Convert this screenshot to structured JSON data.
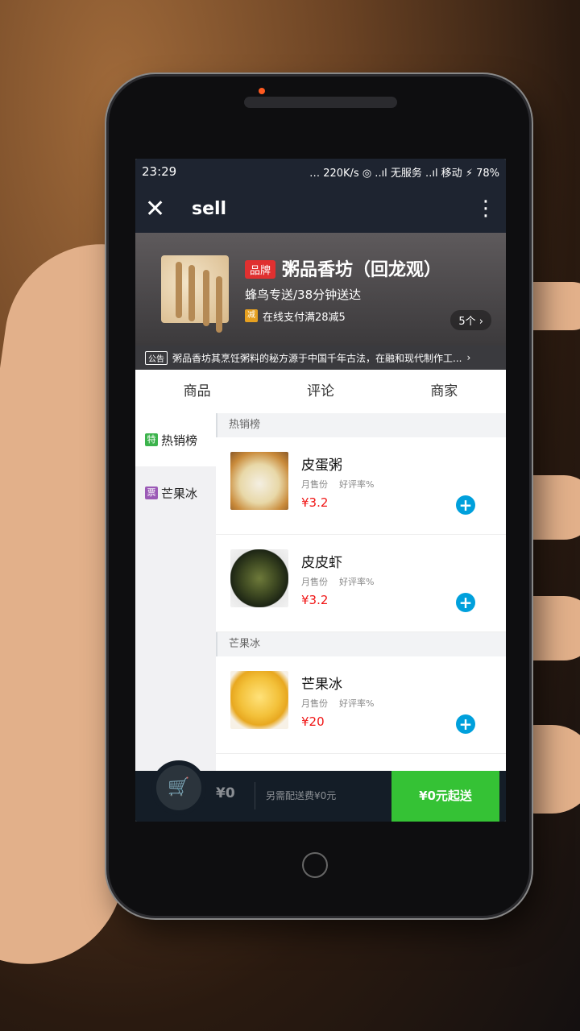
{
  "status_bar": {
    "time": "23:29",
    "indicators": "… 220K/s ◎ ..ıl 无服务 ..ıl 移动 ⚡",
    "battery": "78%"
  },
  "toolbar": {
    "title": "sell"
  },
  "shop": {
    "brand_badge": "品牌",
    "name": "粥品香坊（回龙观）",
    "delivery": "蜂鸟专送/38分钟送达",
    "promo_icon": "减",
    "promo_text": "在线支付满28减5",
    "promo_count": "5个 ›"
  },
  "bulletin": {
    "tag": "公告",
    "text": "粥品香坊其烹饪粥料的秘方源于中国千年古法，在融和现代制作工...",
    "arrow": "›"
  },
  "tabs": [
    "商品",
    "评论",
    "商家"
  ],
  "menu": [
    {
      "icon": "特",
      "icon_color": "#3cb34c",
      "label": "热销榜"
    },
    {
      "icon": "票",
      "icon_color": "#9b59b6",
      "label": "芒果冰"
    }
  ],
  "sections": [
    {
      "title": "热销榜",
      "foods": [
        {
          "name": "皮蛋粥",
          "sales": "月售份",
          "rating": "好评率%",
          "price": "¥3.2",
          "img_color": "#d9b870"
        },
        {
          "name": "皮皮虾",
          "sales": "月售份",
          "rating": "好评率%",
          "price": "¥3.2",
          "img_color": "#4d5a2e"
        }
      ]
    },
    {
      "title": "芒果冰",
      "foods": [
        {
          "name": "芒果冰",
          "sales": "月售份",
          "rating": "好评率%",
          "price": "¥20",
          "img_color": "#f2c94c"
        }
      ]
    }
  ],
  "cart": {
    "price": "¥0",
    "fee": "另需配送费¥0元",
    "checkout": "¥0元起送"
  },
  "icons": {
    "close": "close-icon",
    "more": "more-vertical-icon",
    "cart": "cart-icon",
    "add": "plus-icon"
  }
}
